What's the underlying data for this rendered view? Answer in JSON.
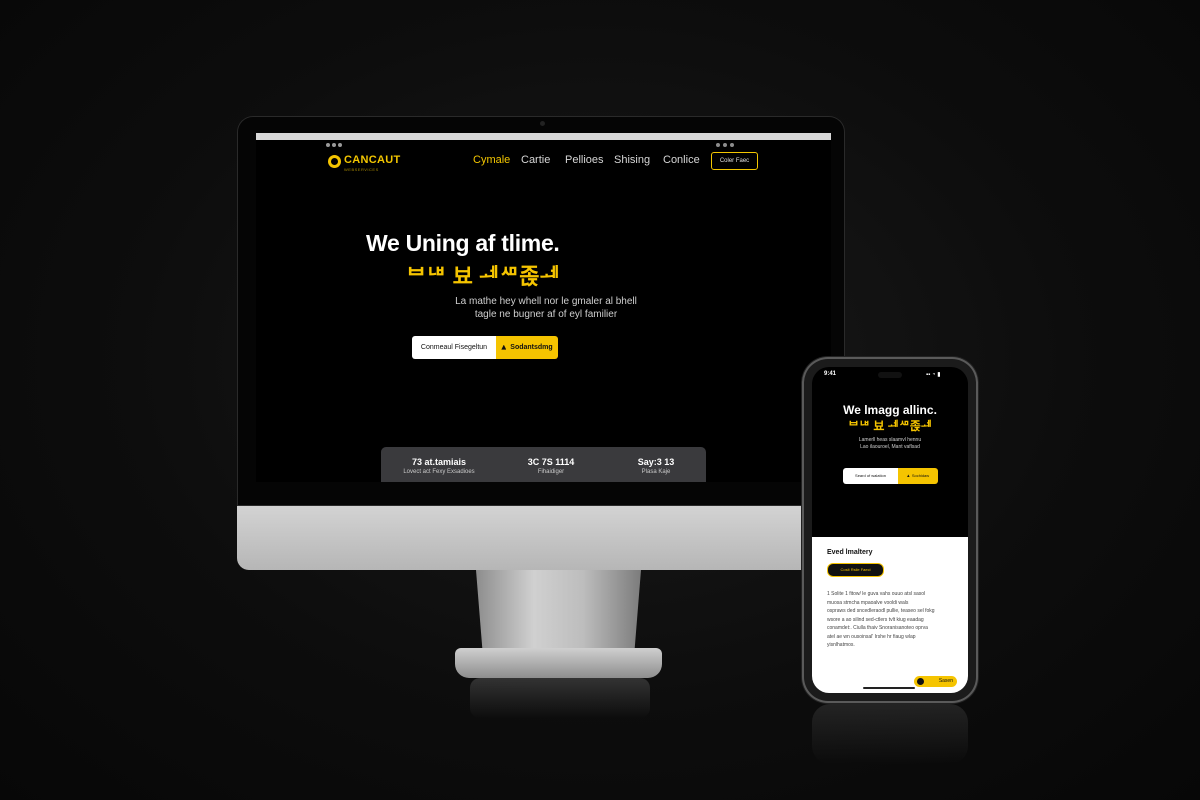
{
  "desktop": {
    "logo": {
      "name": "CANCAUT",
      "tagline": "WEBSERVICES"
    },
    "nav": {
      "items": [
        "Cymale",
        "Cartie",
        "Pellioes",
        "Shising",
        "Conlice"
      ],
      "active_index": 0,
      "cta_label": "Coler Faec"
    },
    "hero": {
      "title": "We Uning af tlime.",
      "subtitle": "ᄇᄖ 뵤 ᆀᄱ졵ᆀ",
      "description_lines": [
        "La mathe hey whell nor le gmaler al bhell",
        "tagle ne bugner af of eyl familier"
      ],
      "primary_button": "Conmeaul Fisegeltun",
      "secondary_button": "Sodantsdmg"
    },
    "stats": [
      {
        "value": "73 at.tamiais",
        "label": "Lovect act Fexy Exsadioes"
      },
      {
        "value": "3C 7S 1114",
        "label": "Fihaidiger"
      },
      {
        "value": "Say:3 13",
        "label": "Plasa Kaje"
      }
    ]
  },
  "phone": {
    "status": {
      "time": "9:41",
      "indicators": "▪▪ ◔ ▮"
    },
    "hero": {
      "title": "We lmagg allinc.",
      "subtitle": "ᄇᄖ 뵤 ᆀᄱ졵ᆀ",
      "description_lines": [
        "Lamerll heas slaamvl hennu",
        "Lao ilaouroel, Mant vaflsad"
      ],
      "primary_button": "Seard of walation",
      "secondary_button": "Sochidaw"
    },
    "panel": {
      "title": "Eved lmaltery",
      "pill_label": "Coslt Rsile Faeci",
      "body_lines": [
        "1 Solite 1 fitow/ le guva vahs ouuo atsl sasol",
        "muosa stmcha mpaoalve vooldi wals",
        "ospraws ded sncedleraodl pullie, teaseo sel fokg",
        "wsore a ao silind sed-ctlers tvlt kiug eaadag",
        "conamdet:. Ciulla thaiv Snoranisanoteo oprva",
        "atel ae wn ousoinsal' Irshe hr fiaug wlap",
        "yisnlhatmos."
      ],
      "float_button": "Sasen"
    }
  },
  "colors": {
    "accent": "#f5c400",
    "background": "#0a0a0a",
    "stats_panel": "#3a3a3d"
  }
}
